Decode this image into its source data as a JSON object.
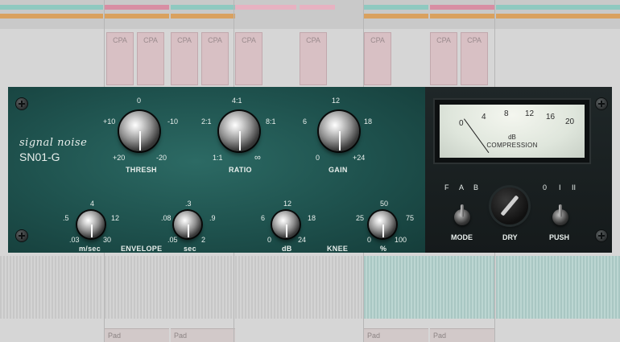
{
  "daw": {
    "clip_label": "CPA",
    "pad_label": "Pad"
  },
  "plugin": {
    "brand_line1": "signal noise",
    "brand_line2": "SN01-G",
    "thresh": {
      "label": "THRESH",
      "ticks": [
        "0",
        "+10",
        "-10",
        "+20",
        "-20"
      ]
    },
    "ratio": {
      "label": "RATIO",
      "ticks": [
        "4:1",
        "2:1",
        "8:1",
        "1:1",
        "∞"
      ]
    },
    "gain": {
      "label": "GAIN",
      "ticks": [
        "12",
        "6",
        "18",
        "0",
        "+24"
      ]
    },
    "envelope": {
      "label": "ENVELOPE",
      "attack": {
        "unit": "m/sec",
        "ticks": [
          "4",
          ".5",
          "12",
          ".03",
          "30"
        ]
      },
      "release": {
        "unit": "sec",
        "ticks": [
          ".3",
          ".08",
          ".9",
          ".05",
          "2"
        ]
      }
    },
    "knee": {
      "label": "KNEE",
      "db": {
        "unit": "dB",
        "ticks": [
          "12",
          "6",
          "18",
          "0",
          "24"
        ]
      },
      "pct": {
        "unit": "%",
        "ticks": [
          "50",
          "25",
          "75",
          "0",
          "100"
        ]
      }
    },
    "meter": {
      "scale": [
        "0",
        "4",
        "8",
        "12",
        "16",
        "20"
      ],
      "unit": "dB",
      "caption": "COMPRESSION"
    },
    "mode": {
      "label": "MODE",
      "options": [
        "F",
        "A",
        "B"
      ]
    },
    "dry": {
      "label": "DRY"
    },
    "push": {
      "label": "PUSH",
      "options": [
        "0",
        "I",
        "II"
      ]
    }
  }
}
